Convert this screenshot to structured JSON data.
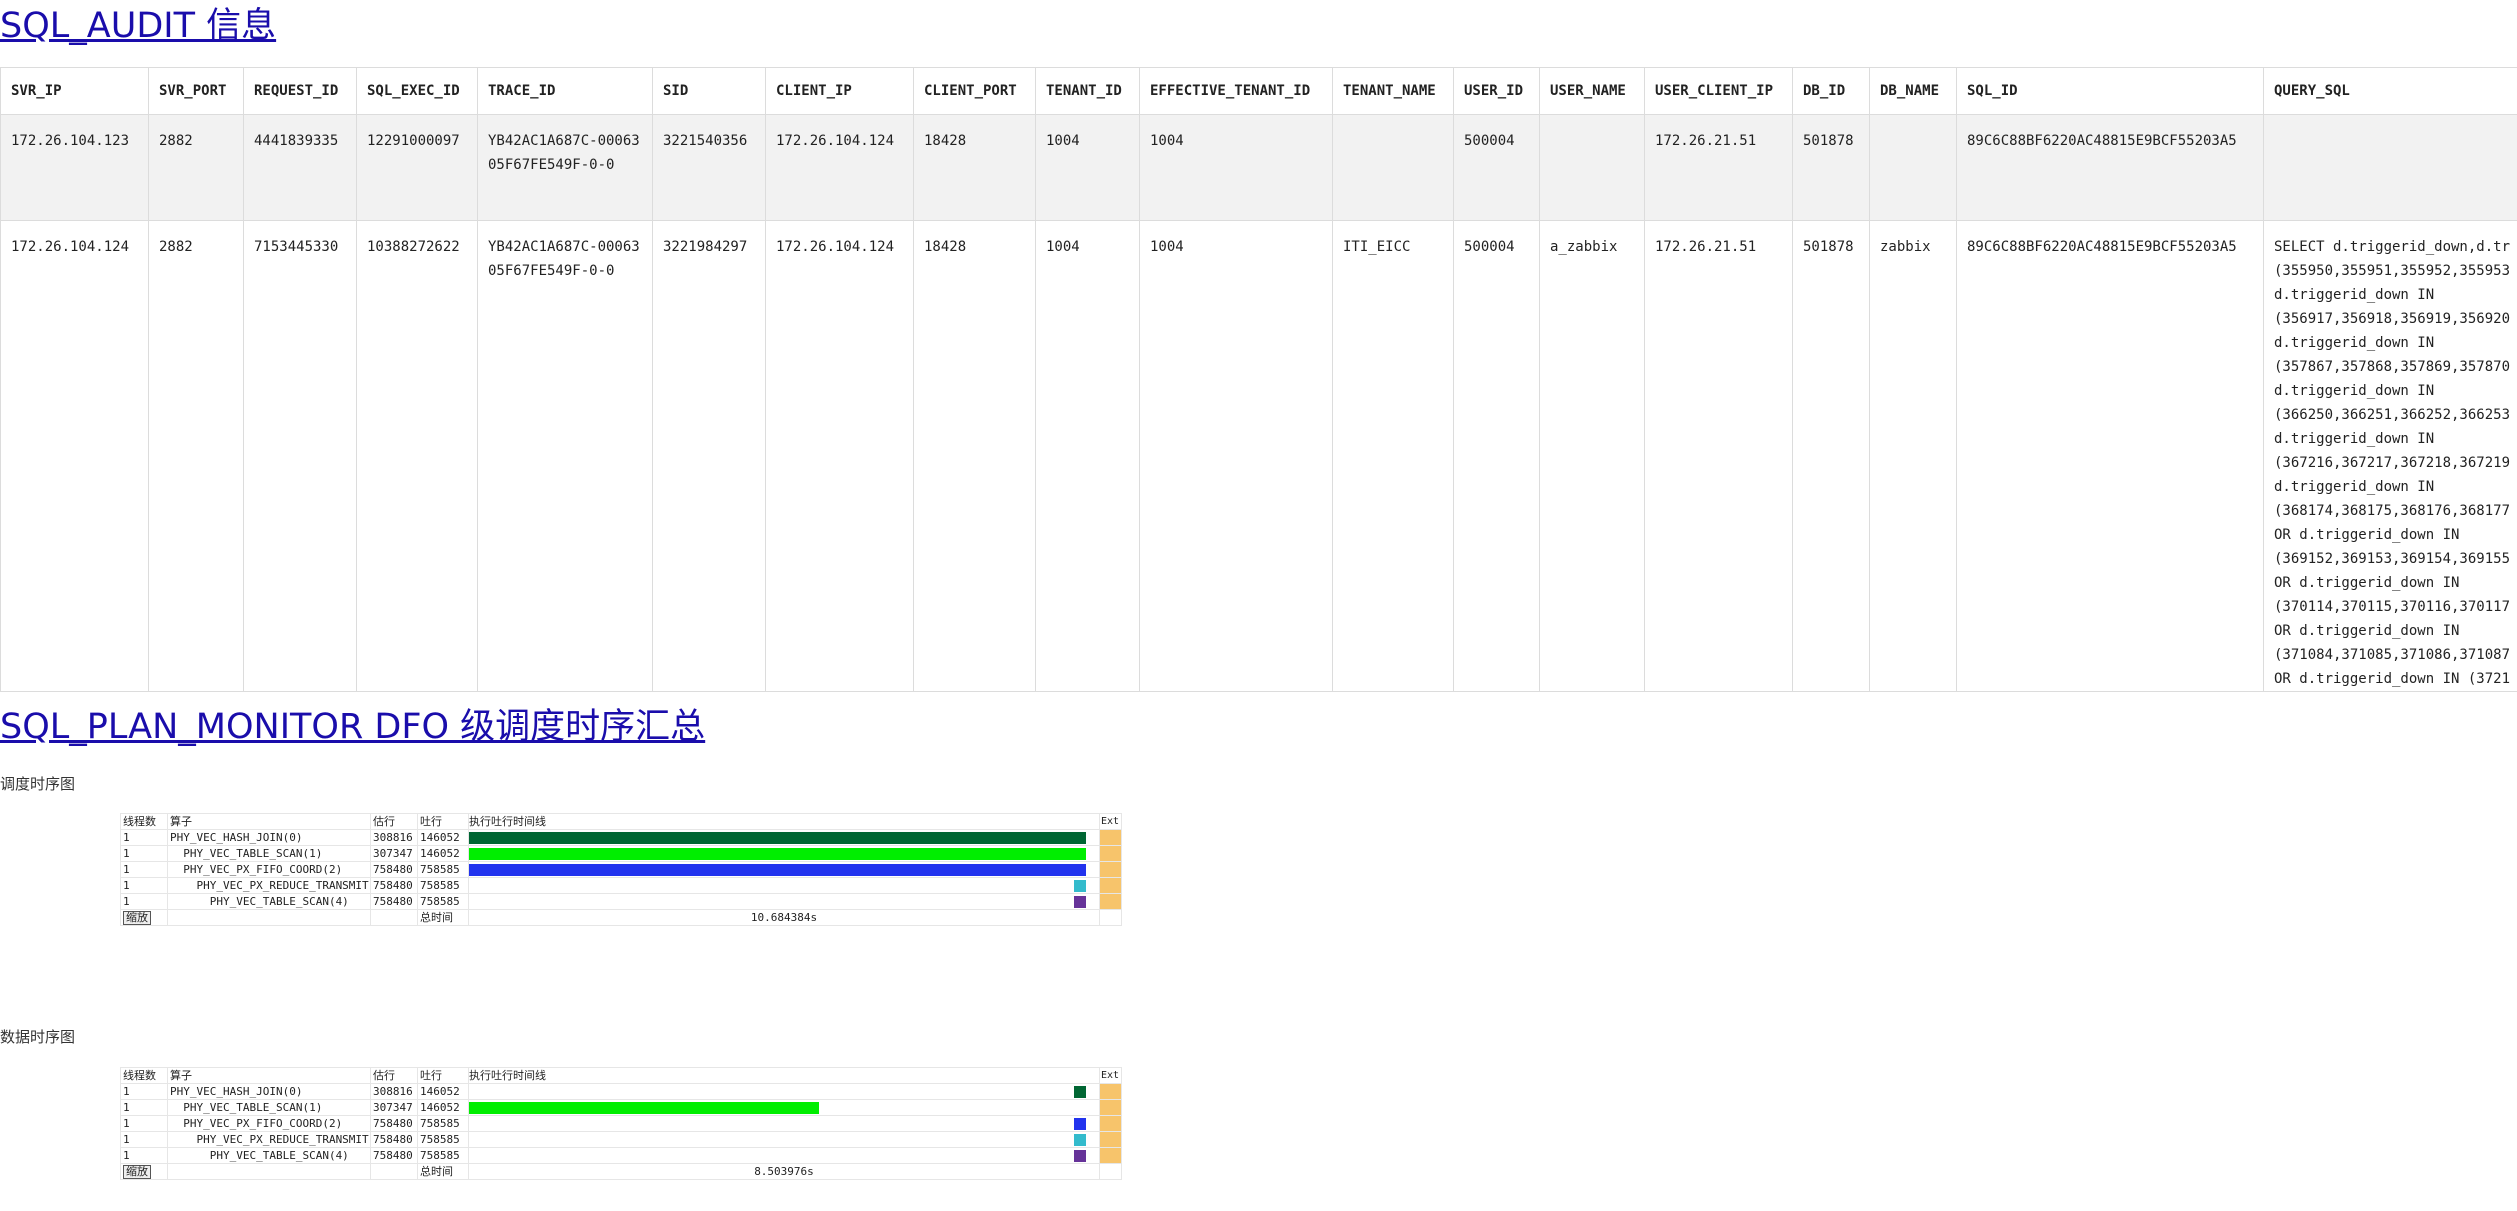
{
  "audit_section": {
    "title": "SQL_AUDIT 信息",
    "columns": [
      "SVR_IP",
      "SVR_PORT",
      "REQUEST_ID",
      "SQL_EXEC_ID",
      "TRACE_ID",
      "SID",
      "CLIENT_IP",
      "CLIENT_PORT",
      "TENANT_ID",
      "EFFECTIVE_TENANT_ID",
      "TENANT_NAME",
      "USER_ID",
      "USER_NAME",
      "USER_CLIENT_IP",
      "DB_ID",
      "DB_NAME",
      "SQL_ID",
      "QUERY_SQL"
    ],
    "rows": [
      {
        "svr_ip": "172.26.104.123",
        "svr_port": "2882",
        "request_id": "4441839335",
        "sql_exec_id": "12291000097",
        "trace_id": "YB42AC1A687C-0006305F67FE549F-0-0",
        "sid": "3221540356",
        "client_ip": "172.26.104.124",
        "client_port": "18428",
        "tenant_id": "1004",
        "effective_tenant_id": "1004",
        "tenant_name": "",
        "user_id": "500004",
        "user_name": "",
        "user_client_ip": "172.26.21.51",
        "db_id": "501878",
        "db_name": "",
        "sql_id": "89C6C88BF6220AC48815E9BCF55203A5",
        "query_sql": ""
      },
      {
        "svr_ip": "172.26.104.124",
        "svr_port": "2882",
        "request_id": "7153445330",
        "sql_exec_id": "10388272622",
        "trace_id": "YB42AC1A687C-0006305F67FE549F-0-0",
        "sid": "3221984297",
        "client_ip": "172.26.104.124",
        "client_port": "18428",
        "tenant_id": "1004",
        "effective_tenant_id": "1004",
        "tenant_name": "ITI_EICC",
        "user_id": "500004",
        "user_name": "a_zabbix",
        "user_client_ip": "172.26.21.51",
        "db_id": "501878",
        "db_name": "zabbix",
        "sql_id": "89C6C88BF6220AC48815E9BCF55203A5",
        "query_sql": "SELECT d.triggerid_down,d.tr\n(355950,355951,355952,355953\nd.triggerid_down IN\n(356917,356918,356919,356920\nd.triggerid_down IN\n(357867,357868,357869,357870\nd.triggerid_down IN\n(366250,366251,366252,366253\nd.triggerid_down IN\n(367216,367217,367218,367219\nd.triggerid_down IN\n(368174,368175,368176,368177\nOR d.triggerid_down IN\n(369152,369153,369154,369155\nOR d.triggerid_down IN\n(370114,370115,370116,370117\nOR d.triggerid_down IN\n(371084,371085,371086,371087\nOR d.triggerid_down IN (3721"
      }
    ]
  },
  "monitor_section": {
    "title": "SQL_PLAN_MONITOR DFO 级调度时序汇总"
  },
  "charts": {
    "headers": {
      "threads": "线程数",
      "operator": "算子",
      "estimated": "估行",
      "output": "吐行",
      "timeline": "执行吐行时间线",
      "ext": "Ext",
      "zoom": "缩放",
      "total_label": "总时间"
    },
    "colors": {
      "ext": "#f7c46b"
    },
    "sched": {
      "title": "调度时序图",
      "total": "10.684384s"
    },
    "data": {
      "title": "数据时序图",
      "total": "8.503976s"
    }
  },
  "chart_data": [
    {
      "type": "gantt",
      "title": "调度时序图",
      "total_time": "10.684384s",
      "rows": [
        {
          "threads": "1",
          "operator": "PHY_VEC_HASH_JOIN(0)",
          "estimated": "308816",
          "output": "146052",
          "start": 0.0,
          "end": 0.98,
          "color": "#006633"
        },
        {
          "threads": "1",
          "operator": "  PHY_VEC_TABLE_SCAN(1)",
          "estimated": "307347",
          "output": "146052",
          "start": 0.0,
          "end": 0.98,
          "color": "#00ee00"
        },
        {
          "threads": "1",
          "operator": "  PHY_VEC_PX_FIFO_COORD(2)",
          "estimated": "758480",
          "output": "758585",
          "start": 0.0,
          "end": 0.98,
          "color": "#2233ee"
        },
        {
          "threads": "1",
          "operator": "    PHY_VEC_PX_REDUCE_TRANSMIT(3)",
          "estimated": "758480",
          "output": "758585",
          "start": 0.96,
          "end": 0.98,
          "color": "#33bbcc"
        },
        {
          "threads": "1",
          "operator": "      PHY_VEC_TABLE_SCAN(4)",
          "estimated": "758480",
          "output": "758585",
          "start": 0.96,
          "end": 0.98,
          "color": "#663399"
        }
      ]
    },
    {
      "type": "gantt",
      "title": "数据时序图",
      "total_time": "8.503976s",
      "rows": [
        {
          "threads": "1",
          "operator": "PHY_VEC_HASH_JOIN(0)",
          "estimated": "308816",
          "output": "146052",
          "start": 0.96,
          "end": 0.98,
          "color": "#006633"
        },
        {
          "threads": "1",
          "operator": "  PHY_VEC_TABLE_SCAN(1)",
          "estimated": "307347",
          "output": "146052",
          "start": 0.0,
          "end": 0.555,
          "color": "#00ee00"
        },
        {
          "threads": "1",
          "operator": "  PHY_VEC_PX_FIFO_COORD(2)",
          "estimated": "758480",
          "output": "758585",
          "start": 0.96,
          "end": 0.98,
          "color": "#2233ee"
        },
        {
          "threads": "1",
          "operator": "    PHY_VEC_PX_REDUCE_TRANSMIT(3)",
          "estimated": "758480",
          "output": "758585",
          "start": 0.96,
          "end": 0.98,
          "color": "#33bbcc"
        },
        {
          "threads": "1",
          "operator": "      PHY_VEC_TABLE_SCAN(4)",
          "estimated": "758480",
          "output": "758585",
          "start": 0.96,
          "end": 0.98,
          "color": "#663399"
        }
      ]
    }
  ]
}
